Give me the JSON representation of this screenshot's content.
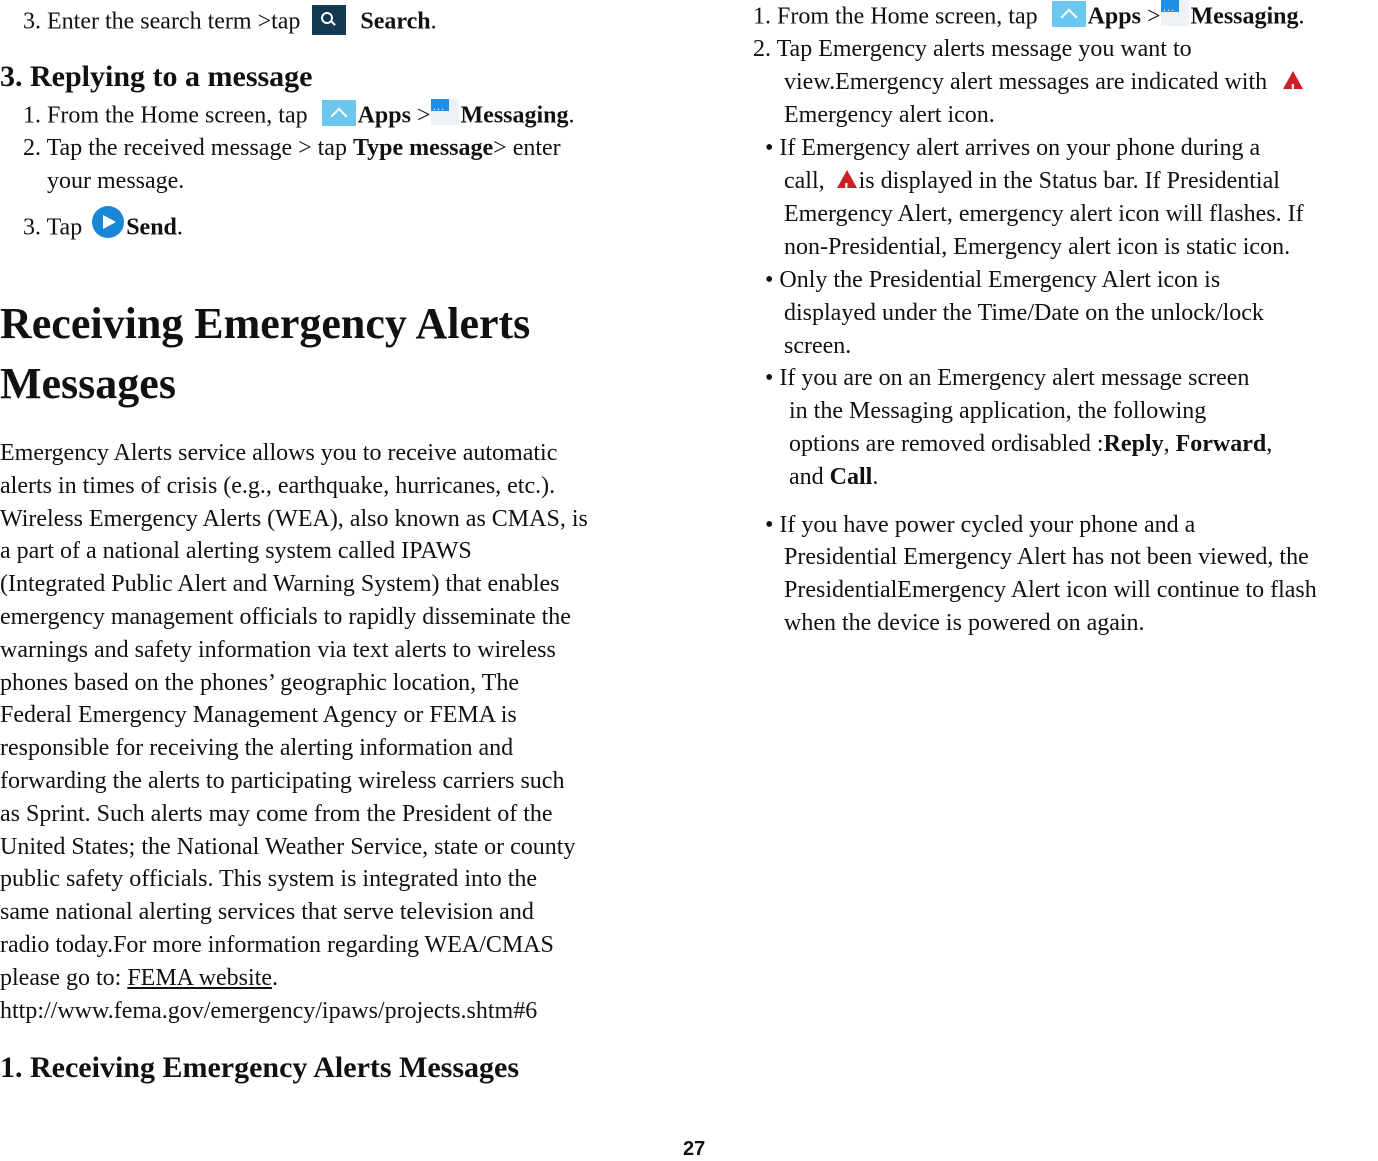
{
  "left": {
    "search_step": {
      "pre": "3. Enter the search term >tap",
      "icon": "search-icon",
      "bold": "Search",
      "post": "."
    },
    "reply_heading": "3. Replying to a message",
    "reply_steps": {
      "s1": {
        "pre": "1. From the Home screen, tap",
        "apps_icon": "apps-icon",
        "apps": "Apps",
        "sep": " >",
        "msg_icon": "messaging-icon",
        "messaging": "Messaging",
        "post": "."
      },
      "s2": {
        "pre": "2. Tap the received message > tap ",
        "bold": "Type message",
        "post": "> enter",
        "cont": "your message."
      },
      "s3": {
        "pre": "3. Tap",
        "icon": "send-icon",
        "bold": "Send",
        "post": "."
      }
    },
    "section_title_line1": "Receiving Emergency Alerts",
    "section_title_line2": "Messages",
    "body_lines": [
      "Emergency Alerts service allows you to receive automatic",
      "alerts in times of crisis (e.g., earthquake, hurricanes, etc.).",
      "Wireless Emergency Alerts (WEA), also known as CMAS, is",
      "a part of a national alerting system called IPAWS",
      "(Integrated Public Alert and Warning System) that enables",
      "emergency management officials to rapidly disseminate the",
      "warnings and safety information via text alerts to wireless",
      "phones based on the phones’ geographic location, The",
      "Federal Emergency Management Agency or FEMA is",
      "responsible for receiving the alerting information and",
      "forwarding the alerts to participating wireless carriers such",
      "as Sprint. Such alerts may come from the President of the",
      "United States; the National Weather Service, state or county",
      "public safety officials. This system is integrated into the",
      "same national alerting services that serve television and",
      "radio today.For more information regarding WEA/CMAS"
    ],
    "goto_pre": "please go to: ",
    "goto_link": "FEMA website",
    "goto_post": ".",
    "url": "http://www.fema.gov/emergency/ipaws/projects.shtm#6",
    "sub_heading": "1. Receiving Emergency Alerts Messages"
  },
  "right": {
    "s1": {
      "pre": "1. From the Home screen, tap",
      "apps": "Apps",
      "sep": " >",
      "messaging": "Messaging",
      "post": "."
    },
    "s2_l1": "2. Tap Emergency alerts message you want to",
    "s2_l2": "view.Emergency alert messages are indicated with",
    "s2_l3": "Emergency alert icon.",
    "b1_l1": "• If Emergency alert arrives on your phone during a",
    "b1_l2_pre": "call,",
    "b1_l2_post": "is displayed in the Status bar. If Presidential",
    "b1_l3": "Emergency Alert, emergency alert icon will flashes. If",
    "b1_l4": "non-Presidential, Emergency alert icon is static icon.",
    "b2_l1": "• Only the Presidential Emergency Alert icon is",
    "b2_l2": "displayed under the Time/Date on the unlock/lock",
    "b2_l3": "screen.",
    "b3_l1": "• If you are on an Emergency alert message screen",
    "b3_l2": "in the Messaging application, the following",
    "b3_l3_pre": "options are removed ordisabled :",
    "b3_reply": "Reply",
    "b3_comma": ", ",
    "b3_forward": "Forward",
    "b3_comma2": ",",
    "b3_l4_pre": "and ",
    "b3_call": "Call",
    "b3_l4_post": ".",
    "b4_l1": "• If you have power cycled your phone and a",
    "b4_l2": "Presidential Emergency Alert has not been viewed, the",
    "b4_l3": "PresidentialEmergency Alert icon will continue to flash",
    "b4_l4": "when the device is powered on again."
  },
  "page_number": "27"
}
